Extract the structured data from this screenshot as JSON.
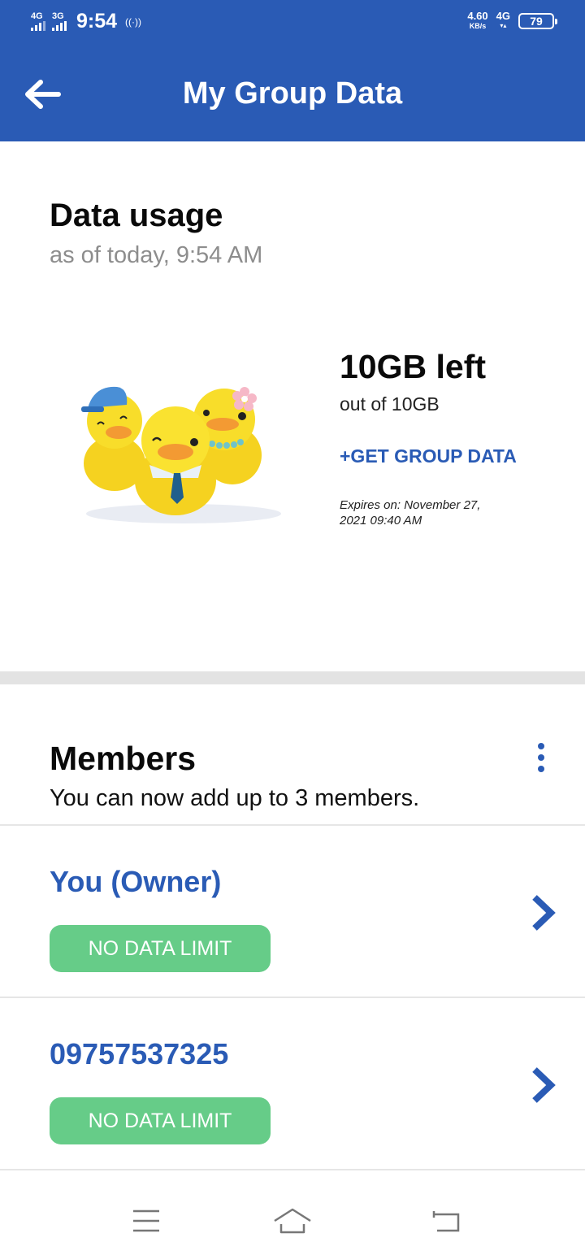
{
  "status_bar": {
    "sim1_network": "4G",
    "sim2_network": "3G",
    "time": "9:54",
    "speed_value": "4.60",
    "speed_unit": "KB/s",
    "network_right": "4G",
    "battery": "79"
  },
  "header": {
    "title": "My Group Data",
    "back_icon": "arrow-left-icon"
  },
  "data_usage": {
    "title": "Data usage",
    "as_of": "as of today, 9:54 AM",
    "remaining": "10GB left",
    "out_of": "out of 10GB",
    "get_group_data": "+GET GROUP DATA",
    "expires": "Expires on: November 27, 2021 09:40 AM"
  },
  "members": {
    "title": "Members",
    "subtitle": "You can now add up to 3 members.",
    "list": [
      {
        "name": "You (Owner)",
        "limit": "NO DATA LIMIT"
      },
      {
        "name": "09757537325",
        "limit": "NO DATA LIMIT"
      }
    ]
  },
  "colors": {
    "primary": "#2a5bb5",
    "badge": "#66cc88",
    "divider": "#e3e3e3"
  },
  "icons": [
    "arrow-left-icon",
    "more-vertical-icon",
    "chevron-right-icon",
    "menu-icon",
    "home-icon",
    "back-nav-icon"
  ]
}
